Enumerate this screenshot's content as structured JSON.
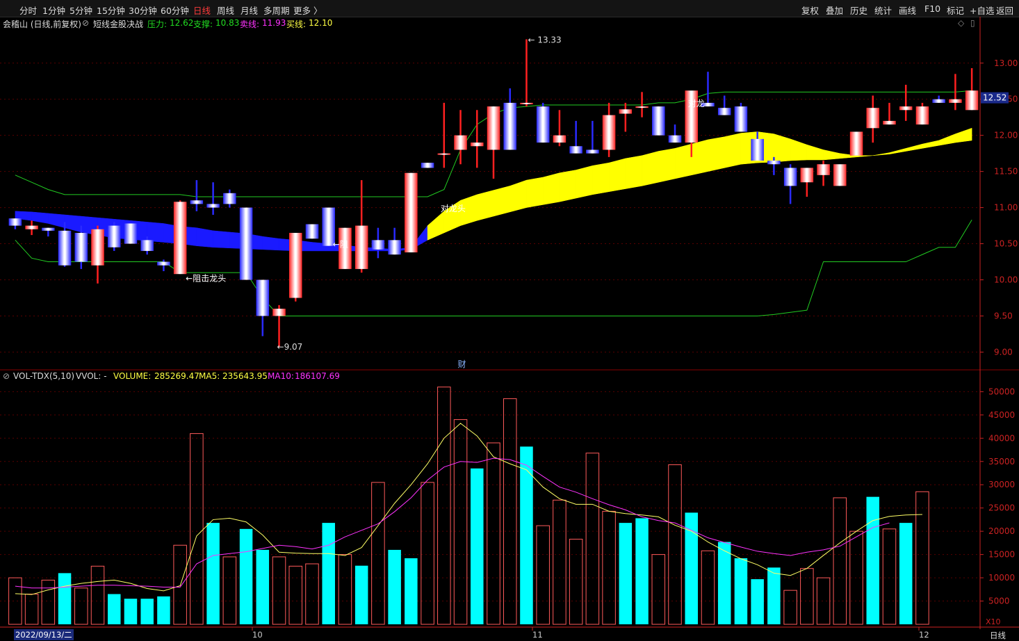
{
  "toolbar": {
    "left_items": [
      "分时",
      "1分钟",
      "5分钟",
      "15分钟",
      "30分钟",
      "60分钟",
      "日线",
      "周线",
      "月线",
      "多周期",
      "更多 〉"
    ],
    "active_index": 6,
    "right_items": [
      "复权",
      "叠加",
      "历史",
      "统计",
      "画线",
      "F10",
      "标记",
      "+自选",
      "返回"
    ]
  },
  "header": {
    "stock": "会稽山 (日线,前复权)",
    "indicator": "短线金股决战",
    "pressure_label": "压力:",
    "pressure_value": "12.62",
    "support_label": "支撑:",
    "support_value": "10.83",
    "sell_label": "卖线:",
    "sell_value": "11.93",
    "buy_label": "买线:",
    "buy_value": "12.10"
  },
  "volume_header": {
    "name": "VOL-TDX(5,10)",
    "vvol": "VVOL: -",
    "volume_label": "VOLUME:",
    "volume_value": "285269.47",
    "ma5_label": "MA5:",
    "ma5_value": "235643.95",
    "ma10_label": "MA10:",
    "ma10_value": "186107.69"
  },
  "colors": {
    "up": "#ff2020",
    "down": "#2222ff",
    "vol_down": "#00ffff",
    "ma5": "#ffff66",
    "ma10": "#ff33ff",
    "band": "#ffff00",
    "support": "#22cc22",
    "grid": "#5a0000",
    "axis": "#cc2222"
  },
  "annotations": {
    "high": "13.33",
    "low": "9.07",
    "resist_dragon": "←阻击龙头",
    "resist_short": "←阻",
    "dragon": "对龙头",
    "dragon2": "对龙",
    "finance": "财",
    "current_price": "12.52"
  },
  "bottom": {
    "date": "2022/09/13/二",
    "label_oct": "10",
    "label_nov": "11",
    "label_dec": "12",
    "period": "日线",
    "multiplier": "X10"
  },
  "chart_data": [
    {
      "type": "candlestick",
      "price_axis_ticks": [
        9.0,
        9.5,
        10.0,
        10.5,
        11.0,
        11.5,
        12.0,
        12.5,
        13.0
      ],
      "ylim": [
        8.85,
        13.45
      ],
      "ohlc": [
        [
          10.85,
          10.85,
          10.7,
          10.75
        ],
        [
          10.7,
          10.82,
          10.62,
          10.75
        ],
        [
          10.72,
          10.72,
          10.6,
          10.68
        ],
        [
          10.68,
          10.8,
          10.18,
          10.2
        ],
        [
          10.65,
          10.75,
          10.15,
          10.25
        ],
        [
          10.2,
          10.75,
          9.95,
          10.7
        ],
        [
          10.75,
          10.8,
          10.4,
          10.45
        ],
        [
          10.78,
          10.78,
          10.5,
          10.5
        ],
        [
          10.55,
          10.6,
          10.35,
          10.4
        ],
        [
          10.25,
          10.28,
          10.12,
          10.2
        ],
        [
          10.08,
          11.1,
          10.08,
          11.08
        ],
        [
          11.1,
          11.38,
          10.95,
          11.05
        ],
        [
          11.05,
          11.35,
          10.9,
          11.0
        ],
        [
          11.2,
          11.25,
          11.0,
          11.05
        ],
        [
          11.0,
          11.0,
          10.0,
          10.0
        ],
        [
          10.0,
          10.0,
          9.22,
          9.5
        ],
        [
          9.5,
          9.65,
          9.07,
          9.6
        ],
        [
          9.75,
          10.65,
          9.7,
          10.65
        ],
        [
          10.77,
          10.77,
          10.57,
          10.57
        ],
        [
          11.0,
          11.0,
          10.47,
          10.47
        ],
        [
          10.15,
          10.72,
          10.15,
          10.72
        ],
        [
          10.15,
          11.38,
          10.1,
          10.75
        ],
        [
          10.55,
          10.72,
          10.3,
          10.42
        ],
        [
          10.55,
          10.72,
          10.35,
          10.35
        ],
        [
          10.38,
          11.48,
          10.38,
          11.48
        ],
        [
          11.62,
          11.62,
          11.55,
          11.55
        ],
        [
          11.75,
          12.45,
          11.55,
          11.75
        ],
        [
          11.8,
          12.35,
          11.6,
          12.0
        ],
        [
          11.85,
          12.35,
          11.55,
          11.9
        ],
        [
          11.8,
          12.4,
          11.4,
          12.4
        ],
        [
          12.45,
          12.65,
          11.8,
          11.8
        ],
        [
          12.45,
          13.33,
          12.4,
          12.45
        ],
        [
          12.4,
          12.45,
          11.9,
          11.9
        ],
        [
          11.9,
          12.35,
          11.85,
          12.0
        ],
        [
          11.85,
          12.2,
          11.85,
          11.75
        ],
        [
          11.8,
          12.2,
          11.75,
          11.75
        ],
        [
          11.8,
          12.45,
          11.7,
          12.28
        ],
        [
          12.3,
          12.45,
          12.05,
          12.36
        ],
        [
          12.4,
          12.6,
          12.25,
          12.4
        ],
        [
          12.4,
          12.4,
          12.0,
          12.0
        ],
        [
          12.0,
          12.15,
          11.95,
          11.9
        ],
        [
          11.9,
          12.6,
          11.7,
          12.62
        ],
        [
          12.45,
          12.88,
          12.45,
          12.4
        ],
        [
          12.38,
          12.55,
          12.28,
          12.28
        ],
        [
          12.4,
          12.45,
          12.05,
          12.05
        ],
        [
          11.95,
          12.05,
          11.65,
          11.65
        ],
        [
          11.65,
          11.7,
          11.45,
          11.6
        ],
        [
          11.55,
          11.6,
          11.05,
          11.3
        ],
        [
          11.35,
          11.55,
          11.15,
          11.55
        ],
        [
          11.45,
          11.65,
          11.3,
          11.6
        ],
        [
          11.3,
          11.45,
          11.3,
          11.6
        ],
        [
          11.72,
          12.05,
          11.72,
          12.05
        ],
        [
          12.1,
          12.55,
          11.9,
          12.38
        ],
        [
          12.15,
          12.45,
          12.15,
          12.2
        ],
        [
          12.35,
          12.7,
          12.2,
          12.4
        ],
        [
          12.15,
          12.45,
          12.15,
          12.4
        ],
        [
          12.5,
          12.55,
          12.45,
          12.45
        ],
        [
          12.45,
          12.85,
          12.35,
          12.5
        ],
        [
          12.35,
          12.93,
          12.35,
          12.62
        ]
      ],
      "pressure_line": [
        11.45,
        11.35,
        11.25,
        11.18,
        11.18,
        11.18,
        11.18,
        11.18,
        11.18,
        11.18,
        11.18,
        11.15,
        11.15,
        11.15,
        11.15,
        11.15,
        11.15,
        11.15,
        11.15,
        11.15,
        11.15,
        11.15,
        11.15,
        11.15,
        11.15,
        11.15,
        11.25,
        11.8,
        12.15,
        12.3,
        12.38,
        12.4,
        12.42,
        12.42,
        12.42,
        12.42,
        12.42,
        12.42,
        12.42,
        12.45,
        12.45,
        12.5,
        12.58,
        12.6,
        12.6,
        12.6,
        12.6,
        12.6,
        12.6,
        12.6,
        12.6,
        12.6,
        12.6,
        12.6,
        12.6,
        12.6,
        12.6,
        12.6,
        12.62
      ],
      "support_line": [
        10.55,
        10.3,
        10.25,
        10.25,
        10.25,
        10.25,
        10.25,
        10.25,
        10.25,
        10.25,
        10.1,
        10.1,
        10.1,
        10.1,
        10.1,
        9.75,
        9.5,
        9.5,
        9.5,
        9.5,
        9.5,
        9.5,
        9.5,
        9.5,
        9.5,
        9.5,
        9.5,
        9.5,
        9.5,
        9.5,
        9.5,
        9.5,
        9.5,
        9.5,
        9.5,
        9.5,
        9.5,
        9.5,
        9.5,
        9.5,
        9.5,
        9.5,
        9.5,
        9.5,
        9.5,
        9.5,
        9.52,
        9.55,
        9.58,
        10.25,
        10.25,
        10.25,
        10.25,
        10.25,
        10.25,
        10.35,
        10.45,
        10.45,
        10.83
      ],
      "band_upper": [
        10.95,
        10.94,
        10.92,
        10.9,
        10.88,
        10.86,
        10.84,
        10.82,
        10.8,
        10.78,
        10.74,
        10.72,
        10.68,
        10.66,
        10.64,
        10.6,
        10.57,
        10.55,
        10.52,
        10.5,
        10.48,
        10.45,
        10.44,
        10.42,
        10.45,
        10.75,
        10.95,
        11.1,
        11.18,
        11.24,
        11.3,
        11.38,
        11.42,
        11.48,
        11.52,
        11.58,
        11.62,
        11.68,
        11.72,
        11.78,
        11.82,
        11.88,
        11.94,
        11.98,
        12.03,
        12.05,
        12.02,
        11.95,
        11.87,
        11.8,
        11.75,
        11.72,
        11.72,
        11.76,
        11.82,
        11.88,
        11.93,
        12.02,
        12.1
      ],
      "band_lower": [
        10.85,
        10.82,
        10.78,
        10.72,
        10.66,
        10.62,
        10.58,
        10.56,
        10.54,
        10.52,
        10.5,
        10.47,
        10.45,
        10.44,
        10.43,
        10.42,
        10.41,
        10.4,
        10.4,
        10.4,
        10.4,
        10.4,
        10.4,
        10.4,
        10.42,
        10.55,
        10.65,
        10.75,
        10.82,
        10.88,
        10.94,
        11.0,
        11.04,
        11.08,
        11.13,
        11.18,
        11.22,
        11.26,
        11.3,
        11.35,
        11.4,
        11.45,
        11.5,
        11.55,
        11.6,
        11.62,
        11.63,
        11.65,
        11.66,
        11.66,
        11.68,
        11.7,
        11.72,
        11.74,
        11.78,
        11.82,
        11.86,
        11.9,
        11.93
      ]
    },
    {
      "type": "bar",
      "volume_axis_ticks": [
        5000,
        10000,
        15000,
        20000,
        25000,
        30000,
        35000,
        40000,
        45000,
        50000
      ],
      "volume_unit": "X10",
      "ylim": [
        0,
        52000
      ],
      "volumes": [
        10000,
        6500,
        9500,
        11000,
        7800,
        12500,
        6500,
        5500,
        5500,
        6000,
        17000,
        41000,
        21800,
        14500,
        20500,
        16000,
        14500,
        12500,
        13000,
        21800,
        15000,
        12600,
        30500,
        16000,
        14200,
        30500,
        51000,
        44000,
        33500,
        39000,
        48500,
        38200,
        21200,
        26700,
        18300,
        36800,
        24300,
        21800,
        22800,
        15000,
        34300,
        24000,
        15800,
        17700,
        14200,
        9700,
        12200,
        7300,
        12000,
        10000,
        27200,
        20000,
        27400,
        20500,
        21800,
        28500
      ],
      "volume_dir": [
        "u",
        "u",
        "u",
        "d",
        "u",
        "u",
        "d",
        "d",
        "d",
        "d",
        "u",
        "u",
        "d",
        "u",
        "d",
        "d",
        "u",
        "u",
        "u",
        "d",
        "u",
        "d",
        "u",
        "d",
        "d",
        "u",
        "u",
        "u",
        "d",
        "u",
        "u",
        "d",
        "u",
        "u",
        "u",
        "u",
        "u",
        "d",
        "d",
        "u",
        "u",
        "d",
        "u",
        "d",
        "d",
        "d",
        "d",
        "u",
        "u",
        "u",
        "u",
        "u",
        "d",
        "u",
        "d",
        "u"
      ],
      "ma5": [
        6600,
        6400,
        7400,
        8200,
        8800,
        9200,
        9500,
        8800,
        7700,
        7200,
        8300,
        19000,
        22500,
        22800,
        22000,
        19200,
        15500,
        15300,
        15200,
        15200,
        14800,
        16500,
        21200,
        26000,
        30000,
        34500,
        40000,
        43200,
        40500,
        36000,
        34500,
        33200,
        29500,
        27000,
        25800,
        25800,
        24300,
        23800,
        23500,
        23100,
        21300,
        20000,
        17700,
        15800,
        14100,
        12800,
        11000,
        10500,
        12000,
        14800,
        17500,
        20000,
        22300,
        23200,
        23500,
        23600
      ],
      "ma10": [
        8200,
        7800,
        7800,
        8000,
        8200,
        8400,
        8400,
        8300,
        8200,
        8000,
        8000,
        13000,
        14800,
        15200,
        15600,
        16300,
        17000,
        16700,
        16200,
        17000,
        18800,
        20200,
        21600,
        24200,
        27200,
        31000,
        33800,
        35000,
        34800,
        35700,
        35400,
        34200,
        31800,
        29500,
        28400,
        27000,
        25700,
        24600,
        23100,
        22300,
        21800,
        20200,
        18600,
        17600,
        16600,
        15700,
        15200,
        14800,
        15500,
        16000,
        16800,
        18800,
        20800,
        21800
      ]
    }
  ]
}
